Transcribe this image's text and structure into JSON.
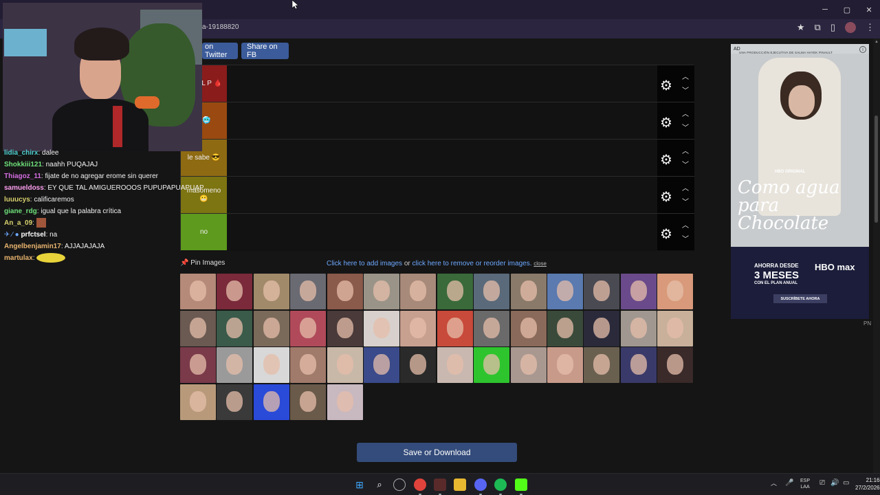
{
  "browser": {
    "url": "a-19188820",
    "window_controls": {
      "minimize": "─",
      "maximize": "▢",
      "close": "✕"
    }
  },
  "share": {
    "twitter": "on Twitter",
    "fb": "Share on FB"
  },
  "tiers": [
    {
      "label": "S DEL P 🩸",
      "color": "#8a1c1c"
    },
    {
      "label": "g 🥶",
      "color": "#9a4a10"
    },
    {
      "label": "le sabe 😎",
      "color": "#8e6a12"
    },
    {
      "label": "masomeno 😬",
      "color": "#7d7412"
    },
    {
      "label": "no",
      "color": "#5e9a1e"
    }
  ],
  "pin_images": "Pin Images",
  "add_images": {
    "add": "Click here to add images",
    "or": " or ",
    "reorder": "click here to remove or reorder images.",
    "close": "close"
  },
  "save_button": "Save or Download",
  "ad": {
    "tag": "AD",
    "subtitle": "UNA PRODUCCIÓN EJECUTIVA DE SALMA HAYEK PINAULT",
    "hbo_original": "HBO ORIGINAL",
    "title": "Como agua para Chocolate",
    "saving_line": "AHORRA DESDE",
    "big": "3 MESES",
    "plan": "CON EL PLAN ANUAL",
    "logo": "HBO max",
    "cta": "SUSCRÍBETE AHORA",
    "pn": "PN"
  },
  "chat": [
    {
      "user": "lidia_chirx",
      "text": " dalee",
      "color": "#4ed1d1"
    },
    {
      "user": "Shokkiii121",
      "text": " naahh PUQAJAJ",
      "color": "#6ee07a"
    },
    {
      "user": "Thiagoz_11",
      "text": " fijate de no agregar erome sin querer",
      "color": "#d36ee0"
    },
    {
      "user": "samueldoss",
      "text": " EY QUE TAL AMIGUEROOOS PUPUPAPUAPUAPL",
      "color": "#ff9ff0"
    },
    {
      "user": "luuucys",
      "text": " calificaremos",
      "color": "#d8d16e"
    },
    {
      "user": "giane_rdg",
      "text": " igual que la palabra crítica",
      "color": "#6ee07a"
    },
    {
      "user": "An_a_09",
      "text": " ",
      "color": "#d8d16e"
    },
    {
      "user": "prfctsel",
      "text": " na",
      "color": "#ffffff"
    },
    {
      "user": "Angelbenjamin17",
      "text": " AJJAJAJAJA",
      "color": "#e8b46e"
    },
    {
      "user": "martulax",
      "text": " ",
      "color": "#e8b46e"
    }
  ],
  "taskbar": {
    "lang1": "ESP",
    "lang2": "LAA",
    "time": "21:16",
    "date": "27/2/2026"
  }
}
